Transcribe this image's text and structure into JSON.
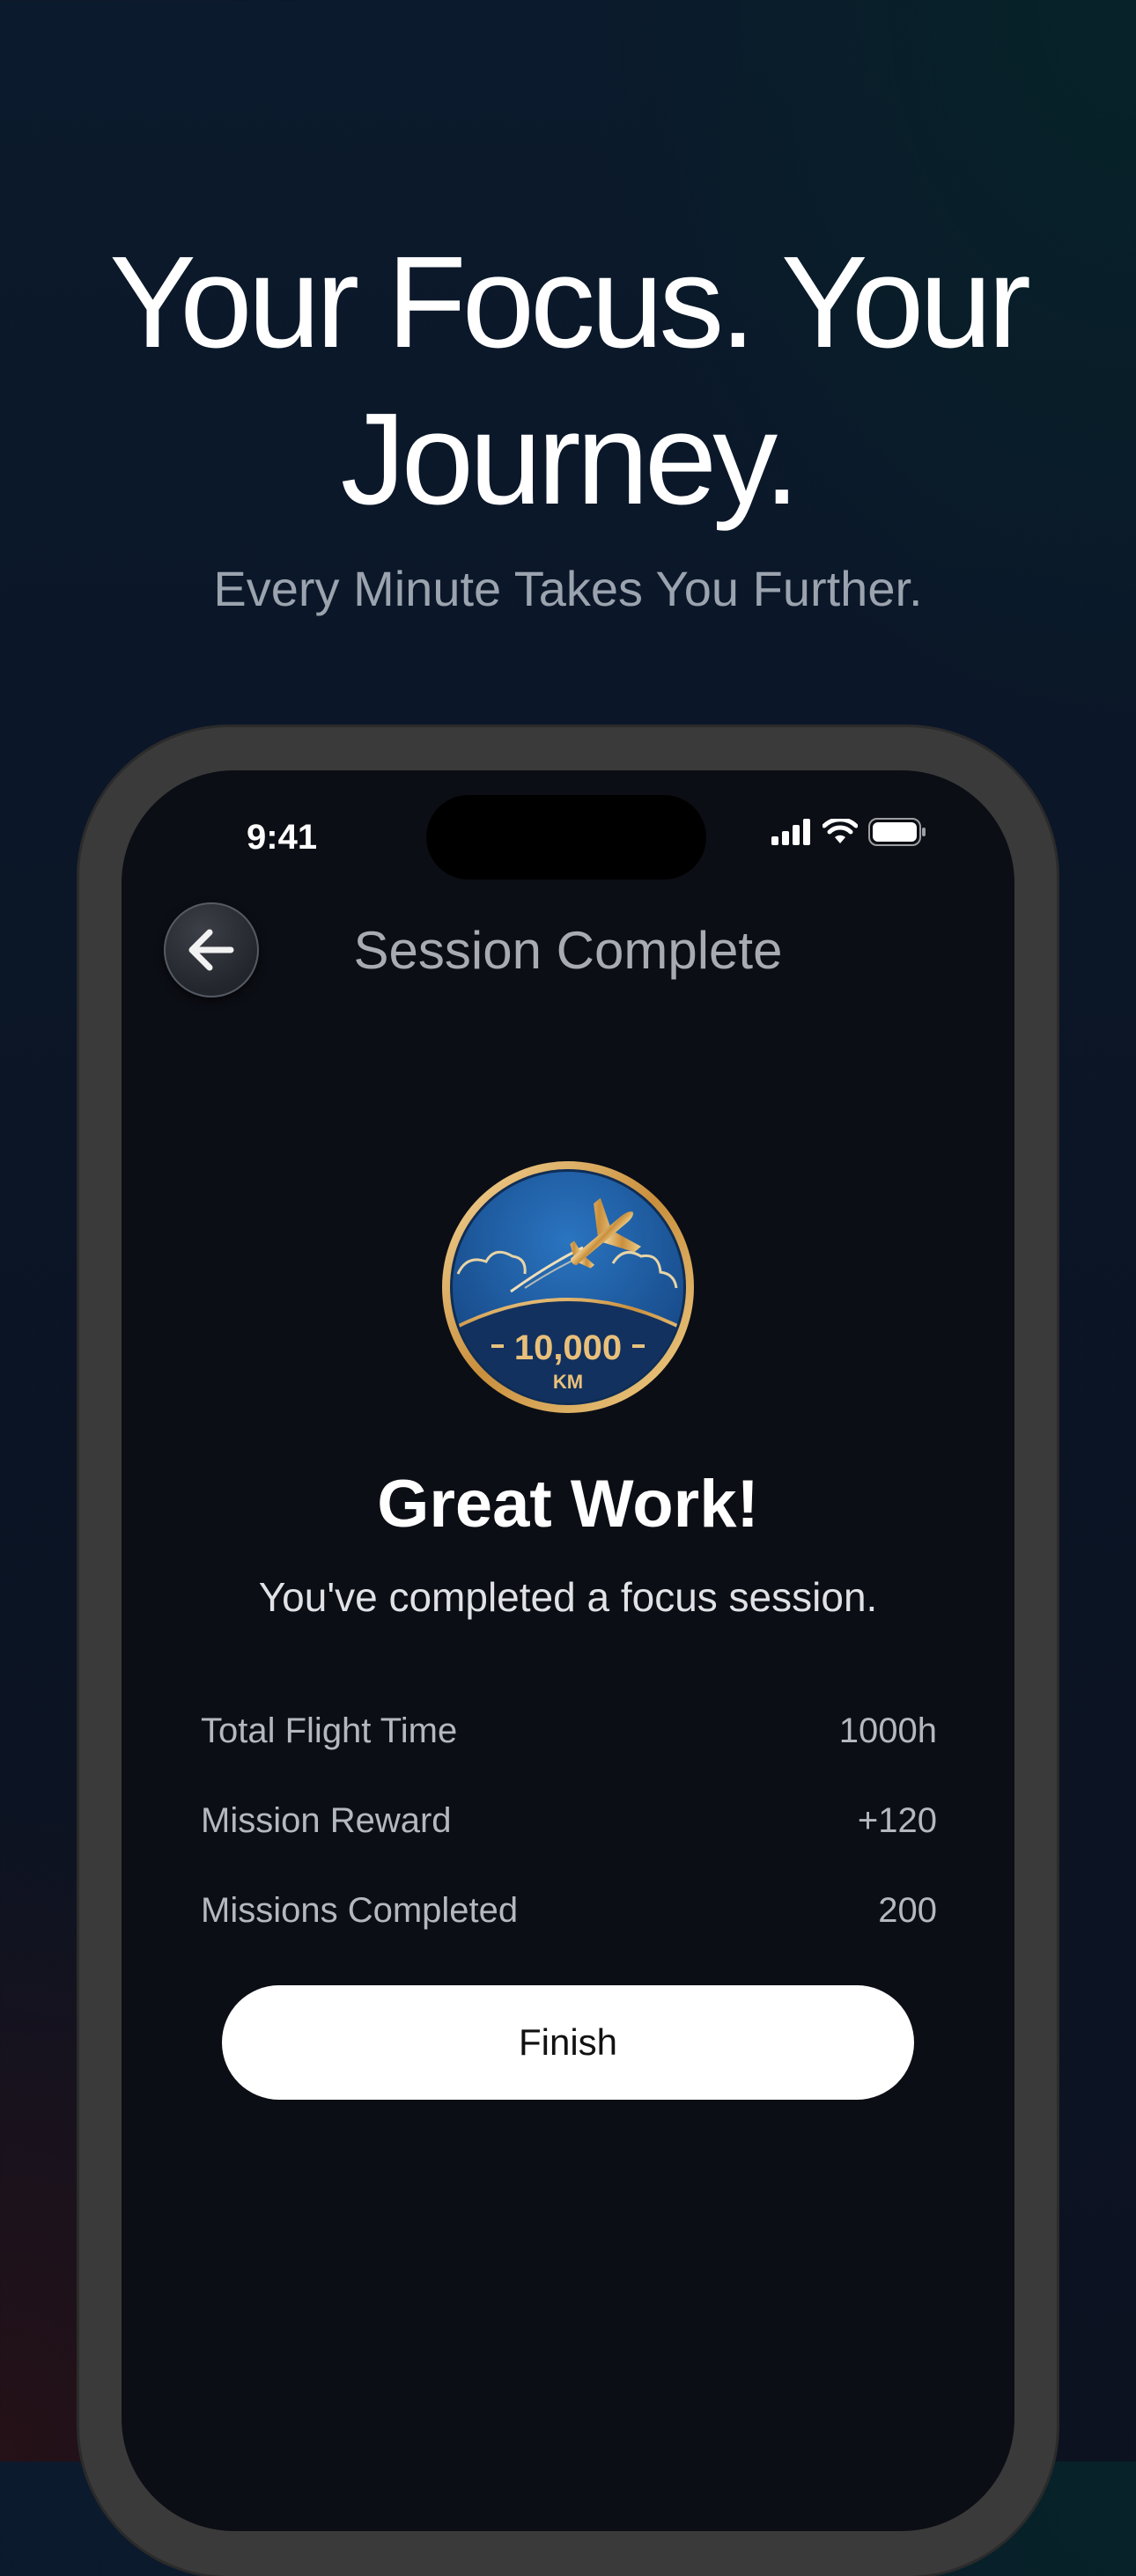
{
  "hero": {
    "headline_line1": "Your Focus. Your",
    "headline_line2": "Journey.",
    "tagline": "Every Minute Takes You Further."
  },
  "status_bar": {
    "time": "9:41",
    "icons": [
      "signal-icon",
      "wifi-icon",
      "battery-icon"
    ]
  },
  "nav": {
    "back_icon": "arrow-left-icon",
    "title": "Session Complete"
  },
  "badge": {
    "distance": "10,000",
    "unit": "KM",
    "icon": "airplane-icon",
    "colors": {
      "gold": "#d9a95a",
      "blue": "#1c5aa0"
    }
  },
  "result": {
    "heading": "Great Work!",
    "message": "You've completed a focus session."
  },
  "stats": [
    {
      "label": "Total Flight Time",
      "value": "1000h"
    },
    {
      "label": "Mission Reward",
      "value": "+120"
    },
    {
      "label": "Missions Completed",
      "value": "200"
    }
  ],
  "actions": {
    "finish_label": "Finish"
  }
}
